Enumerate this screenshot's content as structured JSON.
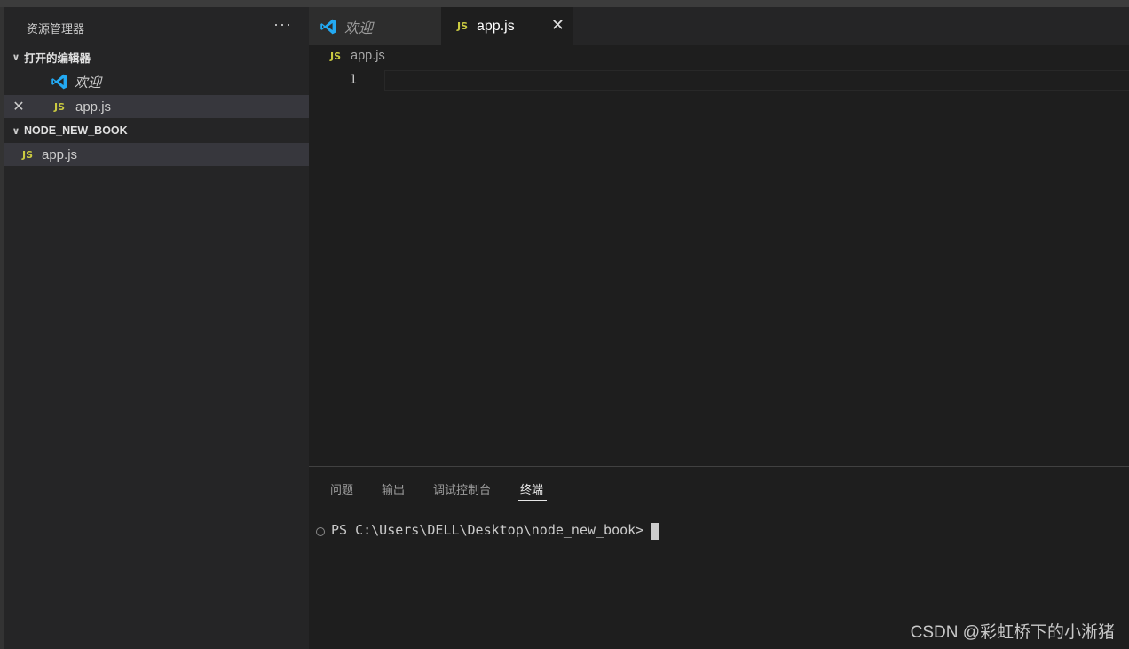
{
  "sidebar": {
    "title": "资源管理器",
    "more_label": "···",
    "open_editors": {
      "heading": "打开的编辑器",
      "items": [
        {
          "label": "欢迎",
          "icon": "vscode-icon"
        },
        {
          "label": "app.js",
          "icon": "js-icon",
          "icon_text": "JS",
          "close_glyph": "✕"
        }
      ]
    },
    "folder": {
      "heading": "NODE_NEW_BOOK",
      "items": [
        {
          "label": "app.js",
          "icon": "js-icon",
          "icon_text": "JS"
        }
      ]
    }
  },
  "tabs": [
    {
      "label": "欢迎",
      "icon": "vscode-icon",
      "active": false
    },
    {
      "label": "app.js",
      "icon": "js-icon",
      "icon_text": "JS",
      "active": true,
      "close_glyph": "✕"
    }
  ],
  "editor": {
    "breadcrumb": {
      "icon_text": "JS",
      "label": "app.js"
    },
    "line_numbers": [
      "1"
    ]
  },
  "panel": {
    "tabs": [
      "问题",
      "输出",
      "调试控制台",
      "终端"
    ],
    "active_tab": "终端",
    "terminal_prompt": "PS C:\\Users\\DELL\\Desktop\\node_new_book>"
  },
  "watermark": "CSDN @彩虹桥下的小淅猪",
  "colors": {
    "editor_bg": "#1e1e1e",
    "sidebar_bg": "#252526",
    "js_yellow": "#cbcb41",
    "vscode_blue": "#23a9f2"
  }
}
